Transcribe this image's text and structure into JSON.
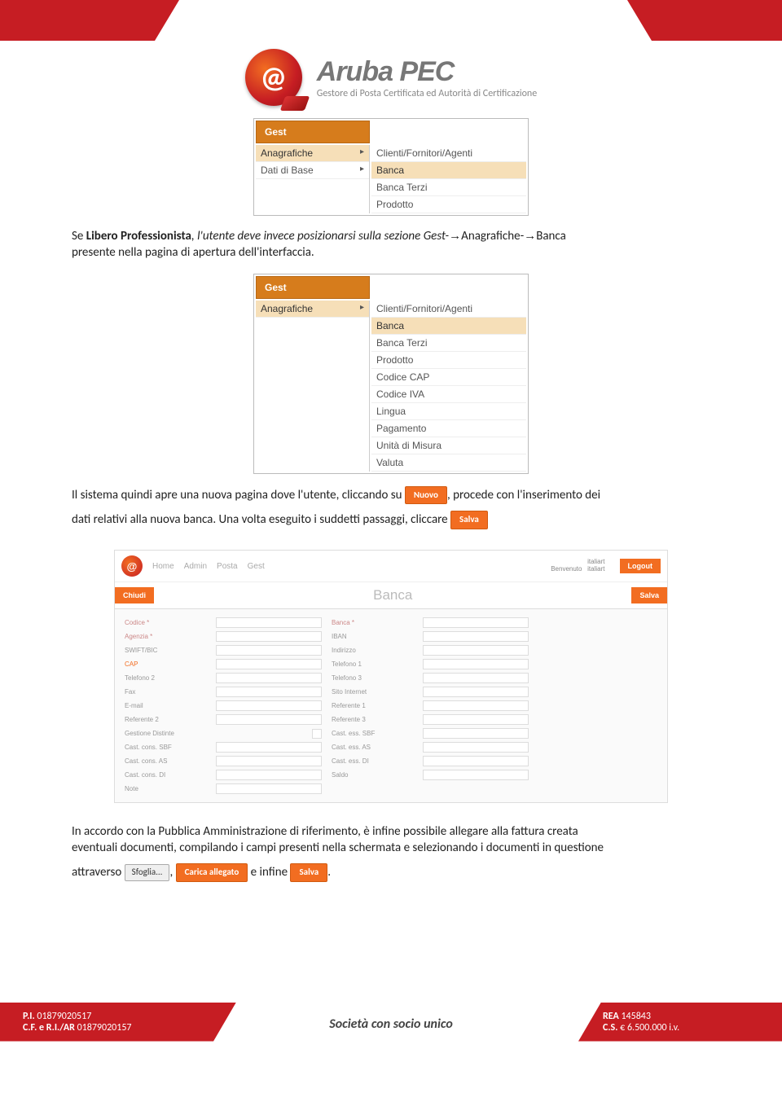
{
  "logo": {
    "title": "Aruba PEC",
    "subtitle": "Gestore di Posta Certificata ed Autorità di Certificazione"
  },
  "menu1": {
    "header": "Gest",
    "left": [
      "Anagrafiche",
      "Dati di Base"
    ],
    "right": [
      "Clienti/Fornitori/Agenti",
      "Banca",
      "Banca Terzi",
      "Prodotto"
    ],
    "highlightLeft": 0,
    "highlightRight": 1
  },
  "para1": {
    "pre": "Se ",
    "bold": "Libero Professionista",
    "post": ", l'utente deve invece posizionarsi sulla sezione Gest-",
    "arrow1": "→",
    "mid1": "Anagrafiche-",
    "arrow2": "→",
    "mid2": "Banca",
    "line2": "presente nella pagina di apertura dell'interfaccia."
  },
  "menu2": {
    "header": "Gest",
    "left": [
      "Anagrafiche"
    ],
    "right": [
      "Clienti/Fornitori/Agenti",
      "Banca",
      "Banca Terzi",
      "Prodotto",
      "Codice CAP",
      "Codice IVA",
      "Lingua",
      "Pagamento",
      "Unità di Misura",
      "Valuta"
    ],
    "highlightLeft": 0,
    "highlightRight": 1
  },
  "para2": {
    "t1": "Il sistema quindi apre una nuova pagina dove l'utente, cliccando su ",
    "chip1": "Nuovo",
    "t2": ", procede con l'inserimento dei",
    "t3": "dati relativi alla nuova banca. Una volta eseguito i suddetti passaggi, cliccare ",
    "chip2": "Salva"
  },
  "form": {
    "nav": [
      "Home",
      "Admin",
      "Posta",
      "Gest"
    ],
    "userTop": "italiart",
    "userWelcome": "Benvenuto",
    "userName": "italiart",
    "logout": "Logout",
    "close": "Chiudi",
    "title": "Banca",
    "save": "Salva",
    "rows": [
      {
        "l1": "Codice *",
        "l2": "Banca *"
      },
      {
        "l1": "Agenzia *",
        "l2": "IBAN"
      },
      {
        "l1": "SWIFT/BIC",
        "l2": "Indirizzo"
      },
      {
        "l1": "CAP",
        "l2": "Telefono 1",
        "l1cls": "orng"
      },
      {
        "l1": "Telefono 2",
        "l2": "Telefono 3"
      },
      {
        "l1": "Fax",
        "l2": "Sito Internet"
      },
      {
        "l1": "E-mail",
        "l2": "Referente 1"
      },
      {
        "l1": "Referente 2",
        "l2": "Referente 3"
      },
      {
        "l1": "Gestione Distinte",
        "l2": "Cast. ess. SBF",
        "chk": true
      },
      {
        "l1": "Cast. cons. SBF",
        "l2": "Cast. ess. AS"
      },
      {
        "l1": "Cast. cons. AS",
        "l2": "Cast. ess. DI"
      },
      {
        "l1": "Cast. cons. DI",
        "l2": "Saldo"
      },
      {
        "l1": "Note",
        "l2": ""
      }
    ]
  },
  "para3": {
    "line1": "In accordo con la Pubblica Amministrazione di riferimento, è infine possibile allegare alla fattura creata",
    "line2": "eventuali documenti, compilando i campi presenti nella schermata e selezionando i documenti in questione",
    "t1": "attraverso ",
    "chip1": "Sfoglia...",
    "t2": ", ",
    "chip2": "Carica allegato",
    "t3": " e infine ",
    "chip3": "Salva",
    "t4": "."
  },
  "footer": {
    "left1_label": "P.I. ",
    "left1_val": "01879020517",
    "left2_label": "C.F. e R.I./AR ",
    "left2_val": "01879020157",
    "center": "Società con socio unico",
    "right1_label": "REA ",
    "right1_val": "145843",
    "right2_label": "C.S. ",
    "right2_val": "€ 6.500.000 i.v."
  }
}
